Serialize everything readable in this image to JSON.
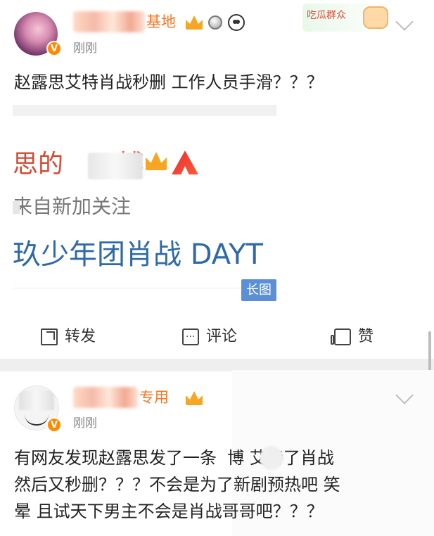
{
  "posts": [
    {
      "username_suffix": "基地",
      "time": "刚刚",
      "text": "赵露思艾特肖战秒删 工作人员手滑？？？",
      "embedded": {
        "title_prefix": "思的",
        "title_suffix": "博",
        "subtitle": "来自新加关注",
        "footer": "玖少年团肖战 DAYT",
        "badge_label": "长图"
      },
      "actions": {
        "repost": "转发",
        "comment": "评论",
        "like": "赞"
      },
      "icons": {
        "crown": "crown-icon",
        "medal": "medal-icon",
        "panda": "panda-icon",
        "verified": "verified-icon",
        "repost": "repost-icon",
        "comment": "comment-icon",
        "like": "like-icon",
        "more": "chevron-down-icon"
      },
      "sticker_text": "吃瓜群众"
    },
    {
      "username_suffix": "专用",
      "time": "刚刚",
      "text_lines": [
        "有网友发现赵露思发了一条  博 艾特了肖战",
        "然后又秒删？？？不会是为了新剧预热吧 笑",
        "晕 且试天下男主不会是肖战哥哥吧？？？"
      ],
      "icons": {
        "crown": "crown-icon",
        "verified": "verified-icon",
        "more": "chevron-down-icon"
      }
    }
  ]
}
